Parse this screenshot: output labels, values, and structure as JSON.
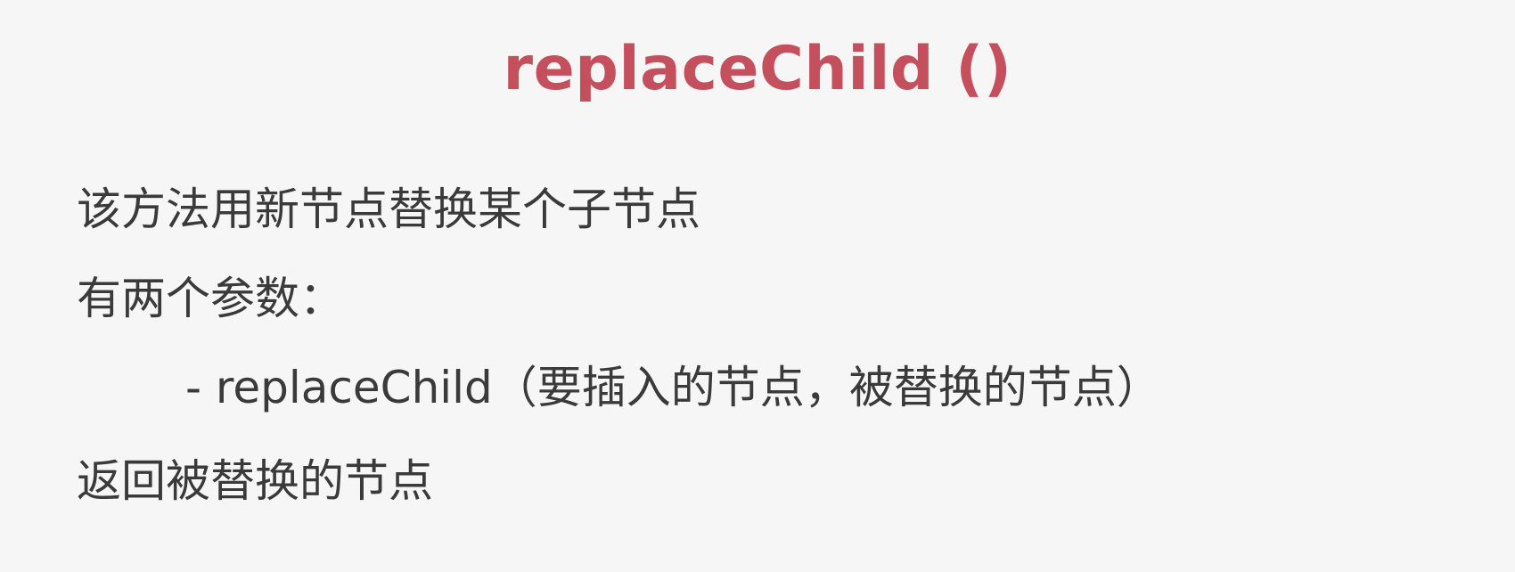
{
  "slide": {
    "title": "replaceChild ()",
    "lines": [
      "该方法用新节点替换某个子节点",
      "有两个参数：",
      "- replaceChild（要插入的节点，被替换的节点）",
      "返回被替换的节点"
    ]
  },
  "colors": {
    "title": "#c4505e",
    "text": "#3a3a3a",
    "background": "#f6f6f6"
  }
}
